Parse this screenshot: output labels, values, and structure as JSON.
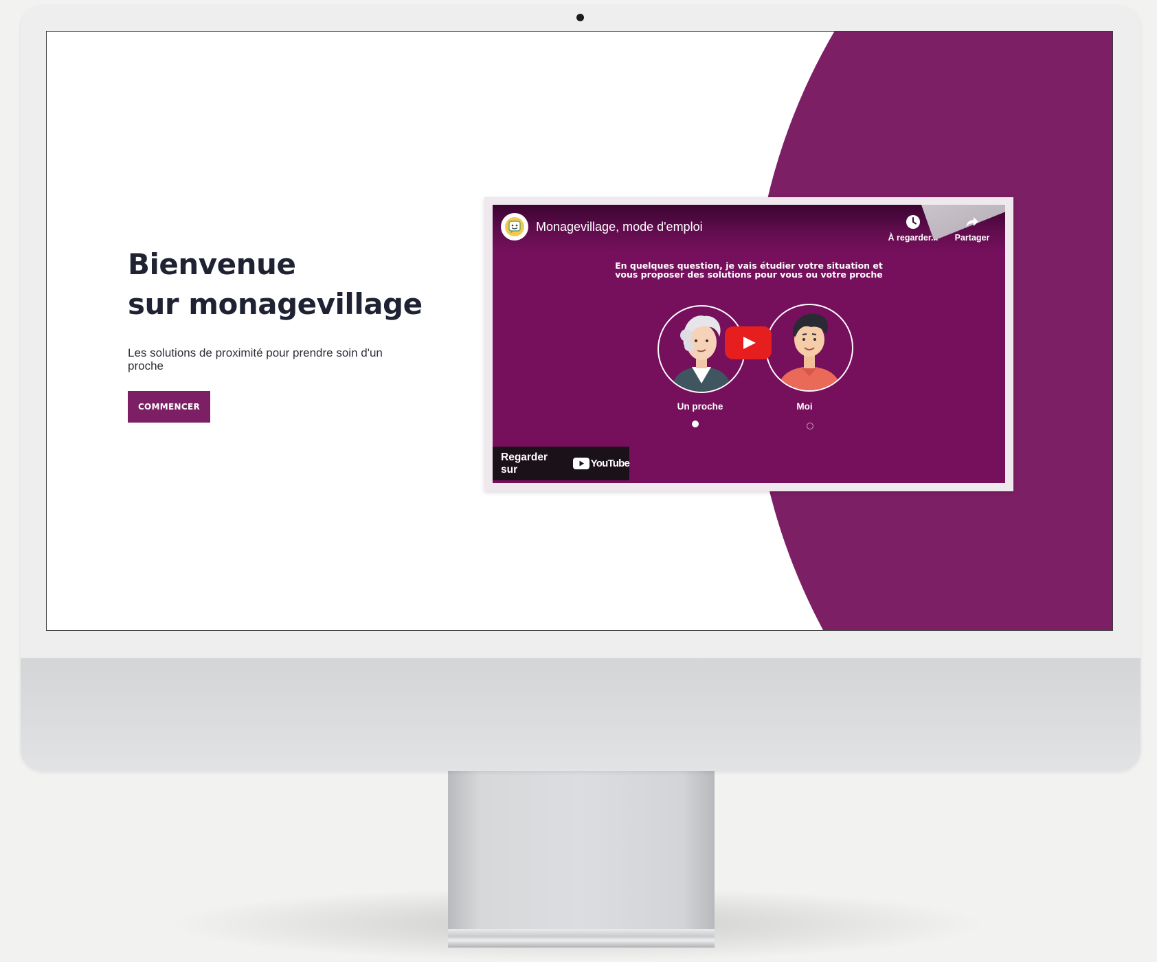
{
  "hero": {
    "title_line1": "Bienvenue",
    "title_line2": "sur monagevillage",
    "subtitle": "Les solutions de proximité pour prendre soin d'un proche",
    "cta_label": "COMMENCER"
  },
  "video": {
    "title": "Monagevillage, mode d'emploi",
    "watch_later_label": "À regarder...",
    "share_label": "Partager",
    "intro_line1": "En quelques question, je vais étudier votre situation et",
    "intro_line2": "vous proposer des solutions pour vous ou votre proche",
    "choice_proche": "Un proche",
    "choice_moi": "Moi",
    "watch_on_label": "Regarder sur",
    "youtube_wordmark": "YouTube"
  },
  "colors": {
    "brand_purple": "#7c1f64",
    "video_purple": "#76105d",
    "youtube_red": "#e61e1e",
    "text_dark": "#1f2233"
  }
}
